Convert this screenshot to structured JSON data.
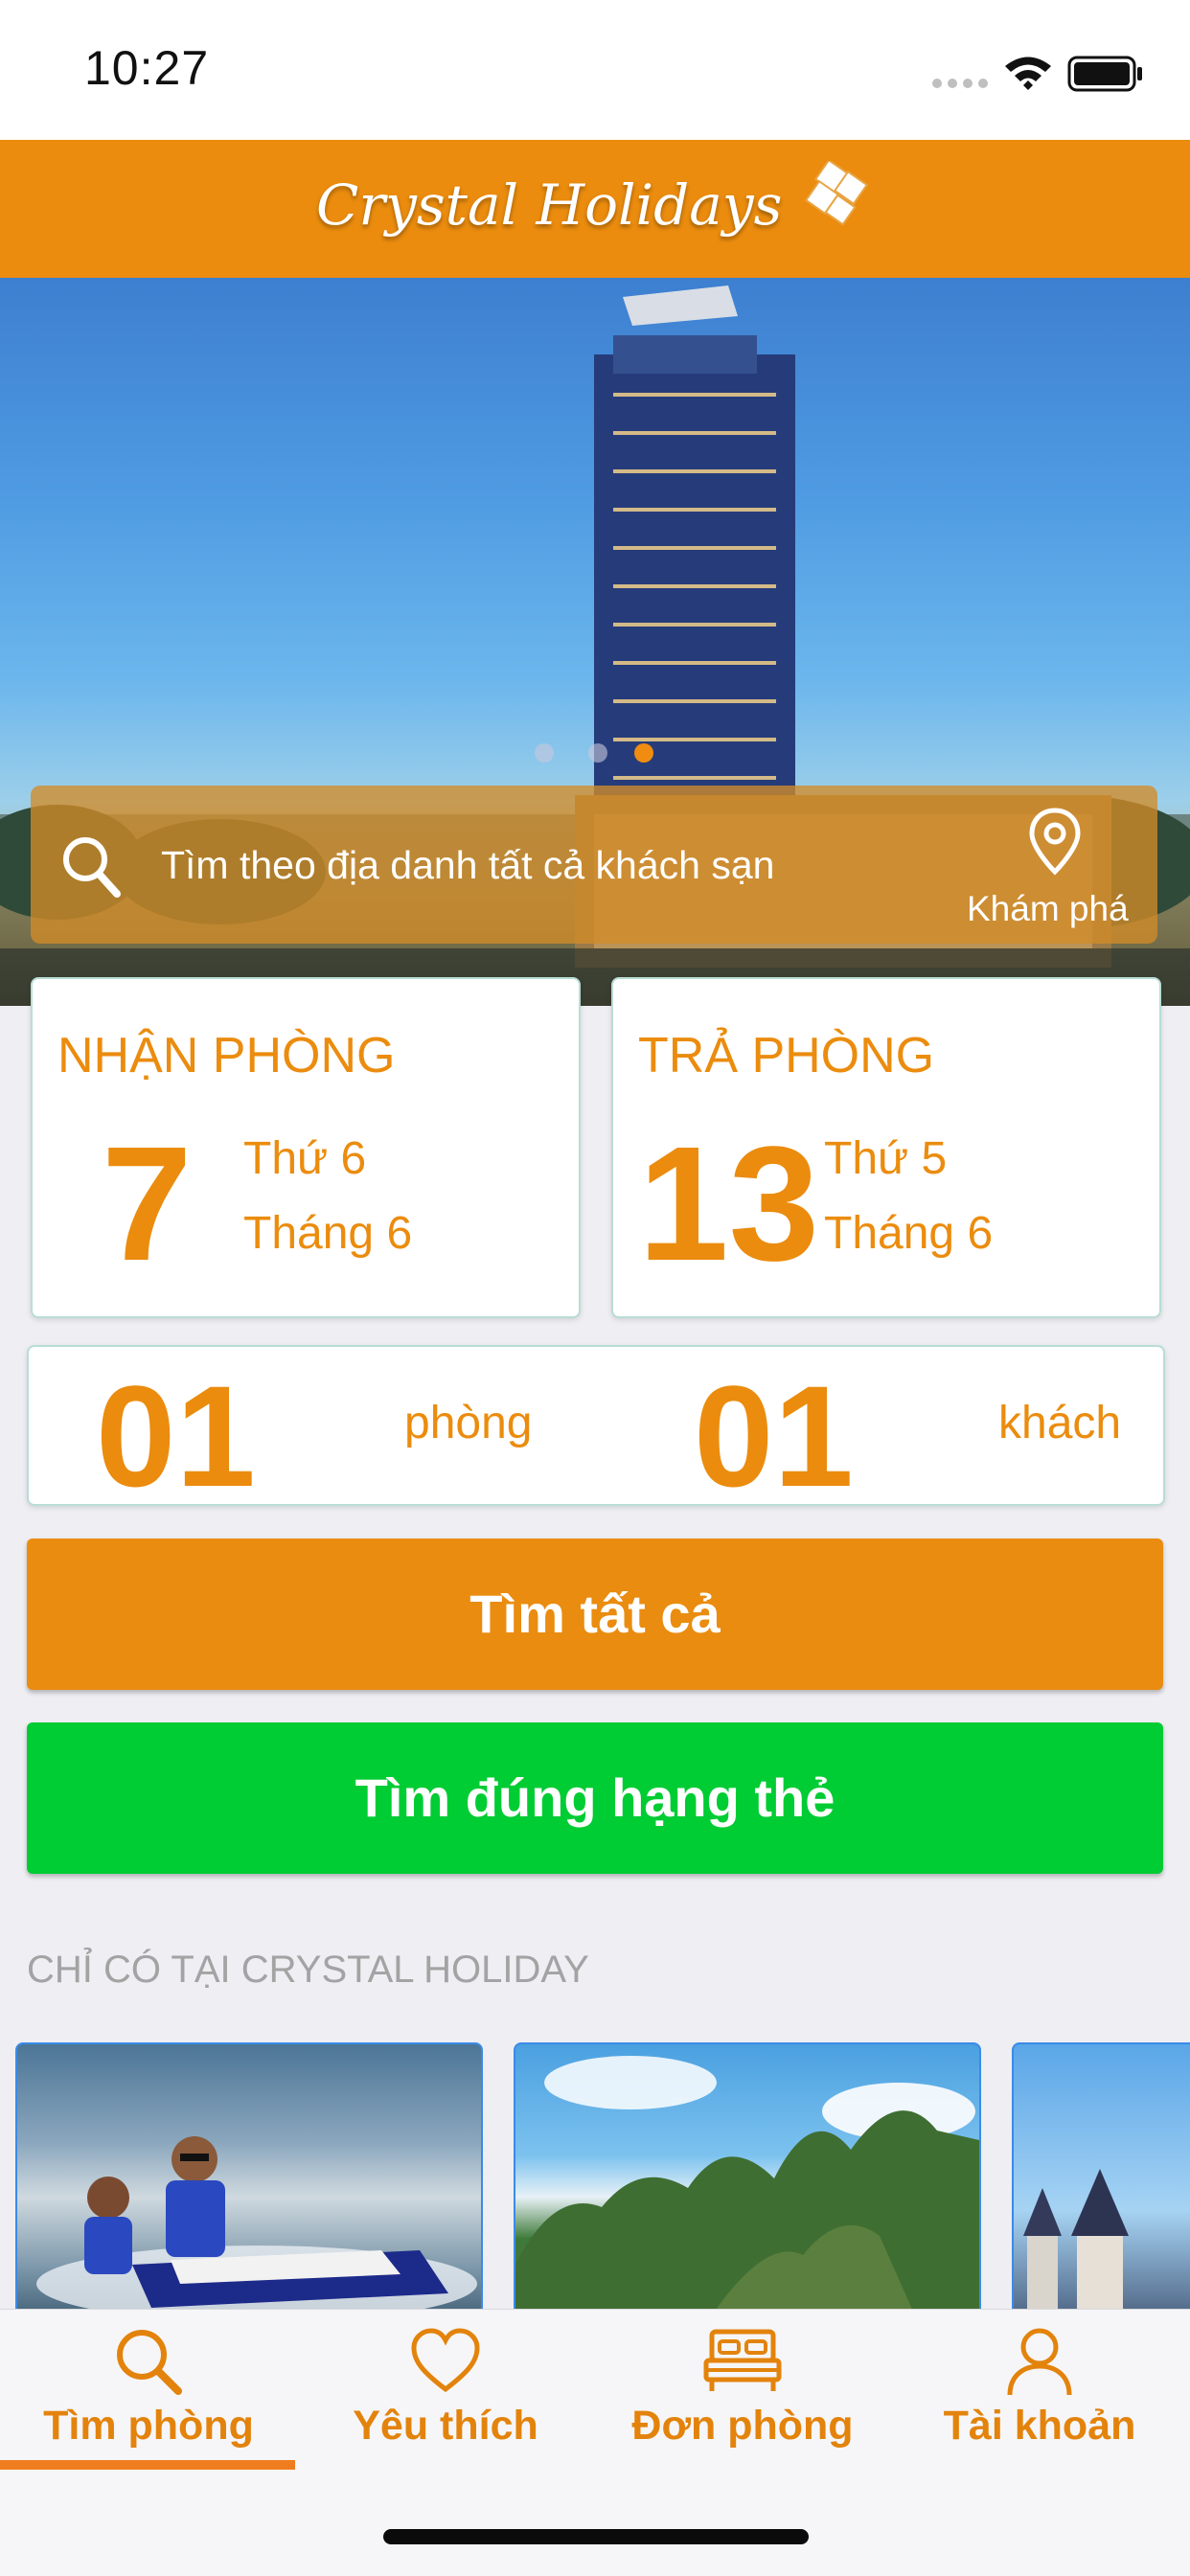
{
  "status_bar": {
    "time": "10:27"
  },
  "header": {
    "brand": "Crystal Holidays"
  },
  "search": {
    "placeholder": "Tìm theo địa danh tất cả khách sạn",
    "explore_label": "Khám phá"
  },
  "checkin": {
    "title": "NHẬN PHÒNG",
    "day": "7",
    "weekday": "Thứ 6",
    "month": "Tháng 6"
  },
  "checkout": {
    "title": "TRẢ PHÒNG",
    "day": "13",
    "weekday": "Thứ 5",
    "month": "Tháng 6"
  },
  "rooms": {
    "count": "01",
    "label": "phòng"
  },
  "guests": {
    "count": "01",
    "label": "khách"
  },
  "buttons": {
    "search_all": "Tìm tất cả",
    "search_tier": "Tìm đúng hạng thẻ"
  },
  "section": {
    "title": "CHỈ CÓ TẠI CRYSTAL HOLIDAY"
  },
  "tabs": [
    {
      "label": "Tìm phòng",
      "icon": "search-icon",
      "active": true
    },
    {
      "label": "Yêu thích",
      "icon": "heart-icon",
      "active": false
    },
    {
      "label": "Đơn phòng",
      "icon": "bed-icon",
      "active": false
    },
    {
      "label": "Tài khoản",
      "icon": "user-icon",
      "active": false
    }
  ],
  "colors": {
    "brand_orange": "#eb8c0e",
    "green": "#00cc33",
    "tab_active": "#ef7d1f"
  }
}
